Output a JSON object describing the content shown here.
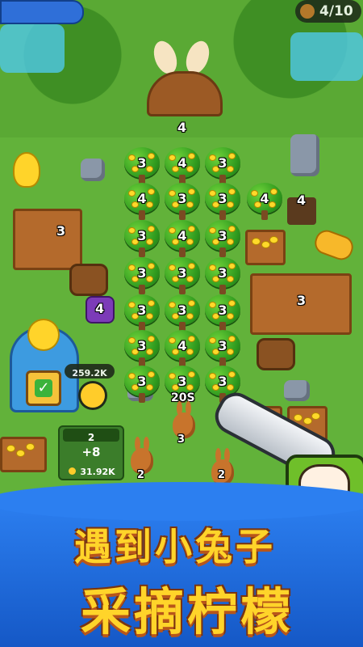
{
  "hud": {
    "bunny_counter": "4/10",
    "bunny_counter_icon": "bunny-icon"
  },
  "world": {
    "building_top_level": "4",
    "building_left_level": "3",
    "building_right_level": "3",
    "mine_cart_level": "4",
    "carrot_stand_level": "4",
    "timer": "20S",
    "coins_balance": "259.2K",
    "tree_levels": [
      [
        "3",
        "4",
        "3"
      ],
      [
        "4",
        "3",
        "3",
        "4"
      ],
      [
        "3",
        "4",
        "3"
      ],
      [
        "3",
        "3",
        "3"
      ],
      [
        "3",
        "3",
        "3"
      ],
      [
        "3",
        "4",
        "3"
      ],
      [
        "3",
        "3",
        "3"
      ]
    ]
  },
  "upgrade_panel": {
    "level": "2",
    "bonus": "+8",
    "cost": "31.92K"
  },
  "bunnies": {
    "left_bunny_level": "2",
    "right_bunny_level": "2",
    "center_bunny_level": "3"
  },
  "banner": {
    "line1": "遇到小兔子",
    "line2": "采摘柠檬"
  },
  "colors": {
    "grass": "#4f9a2e",
    "banner_blue": "#2c7ff0",
    "title_yellow": "#ffd42a"
  }
}
